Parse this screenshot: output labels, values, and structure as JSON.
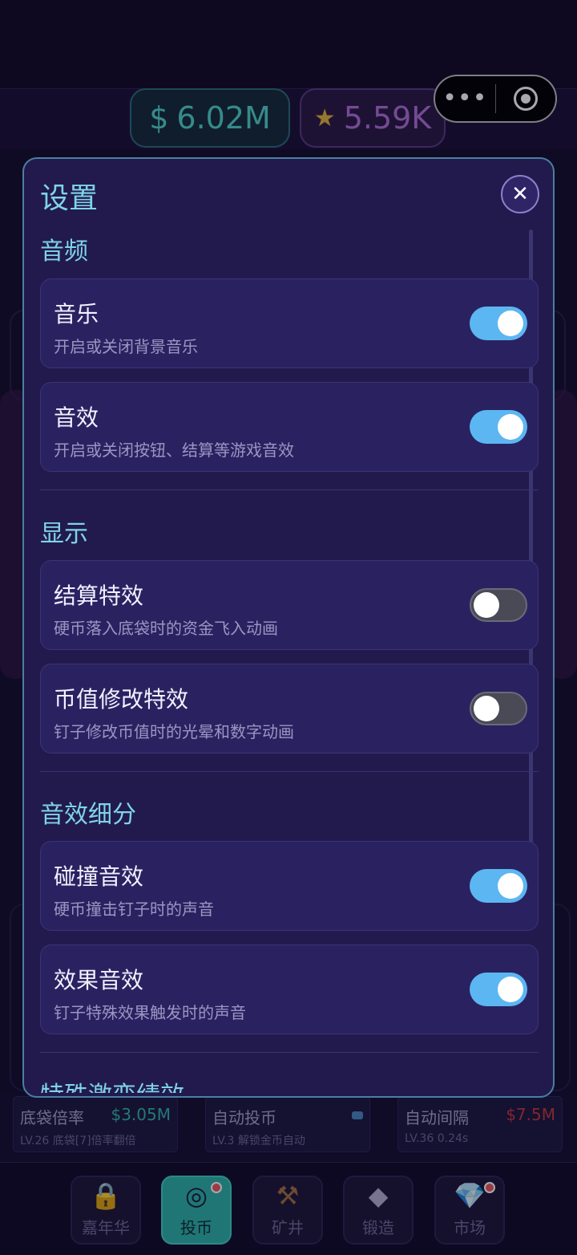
{
  "currency": {
    "money": "6.02M",
    "money_symbol": "$",
    "stars": "5.59K"
  },
  "settings": {
    "title": "设置",
    "sections": [
      {
        "title": "音频",
        "items": [
          {
            "title": "音乐",
            "desc": "开启或关闭背景音乐",
            "on": true
          },
          {
            "title": "音效",
            "desc": "开启或关闭按钮、结算等游戏音效",
            "on": true
          }
        ]
      },
      {
        "title": "显示",
        "items": [
          {
            "title": "结算特效",
            "desc": "硬币落入底袋时的资金飞入动画",
            "on": false
          },
          {
            "title": "币值修改特效",
            "desc": "钉子修改币值时的光晕和数字动画",
            "on": false
          }
        ]
      },
      {
        "title": "音效细分",
        "items": [
          {
            "title": "碰撞音效",
            "desc": "硬币撞击钉子时的声音",
            "on": true
          },
          {
            "title": "效果音效",
            "desc": "钉子特殊效果触发时的声音",
            "on": true
          }
        ]
      }
    ],
    "next_section_cut": "特殊激变绩效"
  },
  "upgrades": [
    {
      "title": "底袋倍率",
      "price": "$3.05M",
      "sub": "LV.26 底袋[7]倍率翻倍",
      "price_color": "#2fb8a8"
    },
    {
      "title": "自动投币",
      "price": "",
      "sub": "LV.3 解锁金币自动",
      "price_color": "#4a86c4"
    },
    {
      "title": "自动间隔",
      "price": "$7.5M",
      "sub": "LV.36 0.24s",
      "price_color": "#c0393b"
    }
  ],
  "nav": [
    {
      "label": "嘉年华",
      "icon": "lock-icon",
      "active": false,
      "badge": false
    },
    {
      "label": "投币",
      "icon": "coin-icon",
      "active": true,
      "badge": true
    },
    {
      "label": "矿井",
      "icon": "pickaxe-icon",
      "active": false,
      "badge": false
    },
    {
      "label": "锻造",
      "icon": "diamond-icon",
      "active": false,
      "badge": false
    },
    {
      "label": "市场",
      "icon": "gem-icon",
      "active": false,
      "badge": true
    }
  ]
}
